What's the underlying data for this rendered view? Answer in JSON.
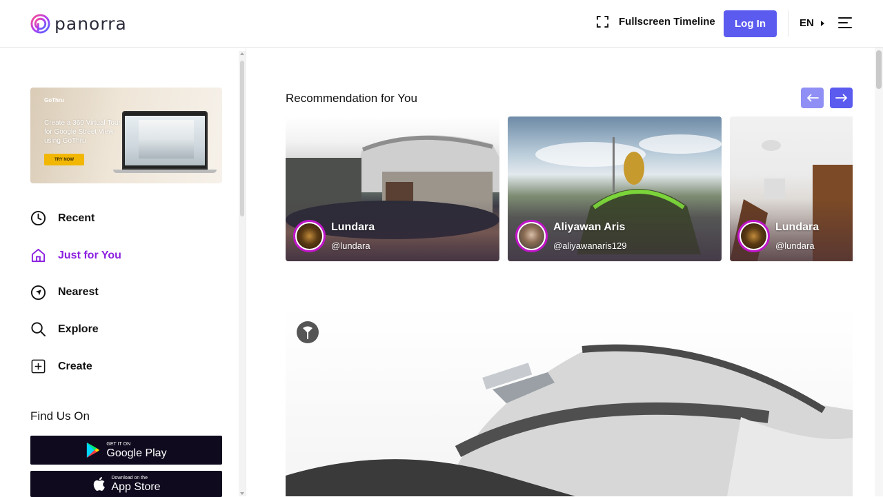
{
  "header": {
    "logo_text": "panorra",
    "fullscreen_label": "Fullscreen Timeline",
    "login_label": "Log In",
    "language": "EN"
  },
  "sidebar": {
    "banner": {
      "brand": "GoThru",
      "text": "Create a 360 Virtual Tour for Google Street View using GoThru",
      "button": "TRY NOW"
    },
    "nav": [
      {
        "label": "Recent",
        "icon": "clock-icon",
        "active": false
      },
      {
        "label": "Just for You",
        "icon": "home-icon",
        "active": true
      },
      {
        "label": "Nearest",
        "icon": "navigation-icon",
        "active": false
      },
      {
        "label": "Explore",
        "icon": "search-icon",
        "active": false
      },
      {
        "label": "Create",
        "icon": "plus-square-icon",
        "active": false
      }
    ],
    "find_us": "Find Us On",
    "google_play": {
      "small": "GET IT ON",
      "big": "Google Play"
    },
    "app_store": {
      "small": "Download on the",
      "big": "App Store"
    }
  },
  "main": {
    "recommendation_title": "Recommendation for You",
    "cards": [
      {
        "name": "Lundara",
        "handle": "@lundara"
      },
      {
        "name": "Aliyawan Aris",
        "handle": "@aliyawanaris129"
      },
      {
        "name": "Lundara",
        "handle": "@lundara"
      }
    ]
  },
  "colors": {
    "accent": "#5b5bf0",
    "active_nav": "#8b1fe0",
    "avatar_ring": "#c015c9",
    "store_bg": "#0f0a1e"
  }
}
